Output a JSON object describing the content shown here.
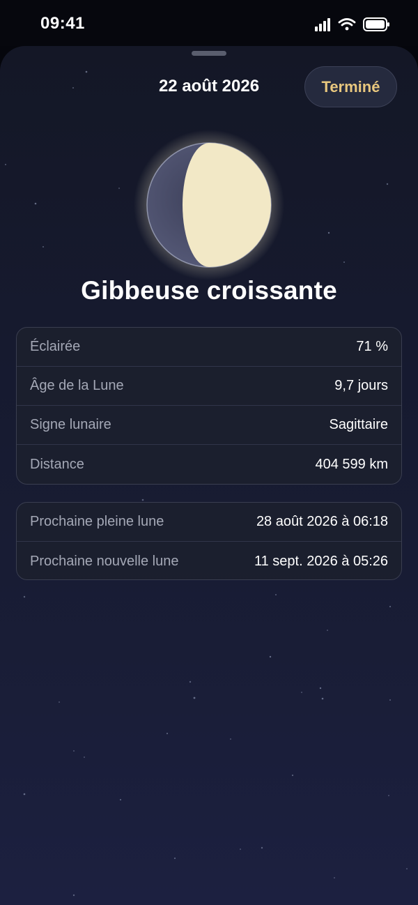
{
  "status_bar": {
    "time": "09:41"
  },
  "header": {
    "date": "22 août 2026",
    "done_label": "Terminé"
  },
  "moon": {
    "phase_name": "Gibbeuse croissante",
    "illumination": 0.71,
    "colors": {
      "lit": "#f2e8c6",
      "dark": "#4a4d66",
      "glow": "#f3e9c8"
    }
  },
  "details": {
    "rows": [
      {
        "label": "Éclairée",
        "value": "71 %"
      },
      {
        "label": "Âge de la Lune",
        "value": "9,7 jours"
      },
      {
        "label": "Signe lunaire",
        "value": "Sagittaire"
      },
      {
        "label": "Distance",
        "value": "404 599 km"
      }
    ]
  },
  "events": {
    "rows": [
      {
        "label": "Prochaine pleine lune",
        "value": "28 août 2026 à 06:18"
      },
      {
        "label": "Prochaine nouvelle lune",
        "value": "11 sept. 2026 à 05:26"
      }
    ]
  },
  "theme": {
    "accent": "#e8c77e",
    "background": "#161a2f"
  }
}
